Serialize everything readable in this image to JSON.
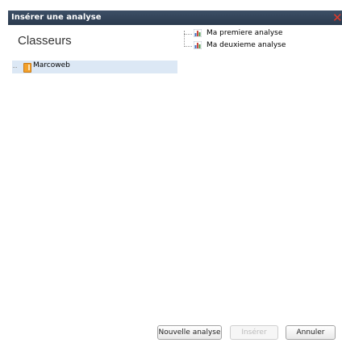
{
  "dialog": {
    "title": "Insérer une analyse",
    "close_glyph": "✕"
  },
  "left": {
    "heading": "Classeurs",
    "workbooks": [
      {
        "label": "Marcoweb",
        "icon": "workbook-icon",
        "selected": true
      }
    ]
  },
  "right": {
    "analyses": [
      {
        "label": "Ma premiere analyse",
        "icon": "chart-icon"
      },
      {
        "label": "Ma deuxieme analyse",
        "icon": "chart-icon"
      }
    ]
  },
  "buttons": {
    "new_analysis": "Nouvelle analyse",
    "insert": "Insérer",
    "cancel": "Annuler"
  },
  "colors": {
    "titlebar": "#2f3e52",
    "close": "#e23a2a",
    "selection": "#dce8f5",
    "workbook_icon": "#f3a12b"
  }
}
